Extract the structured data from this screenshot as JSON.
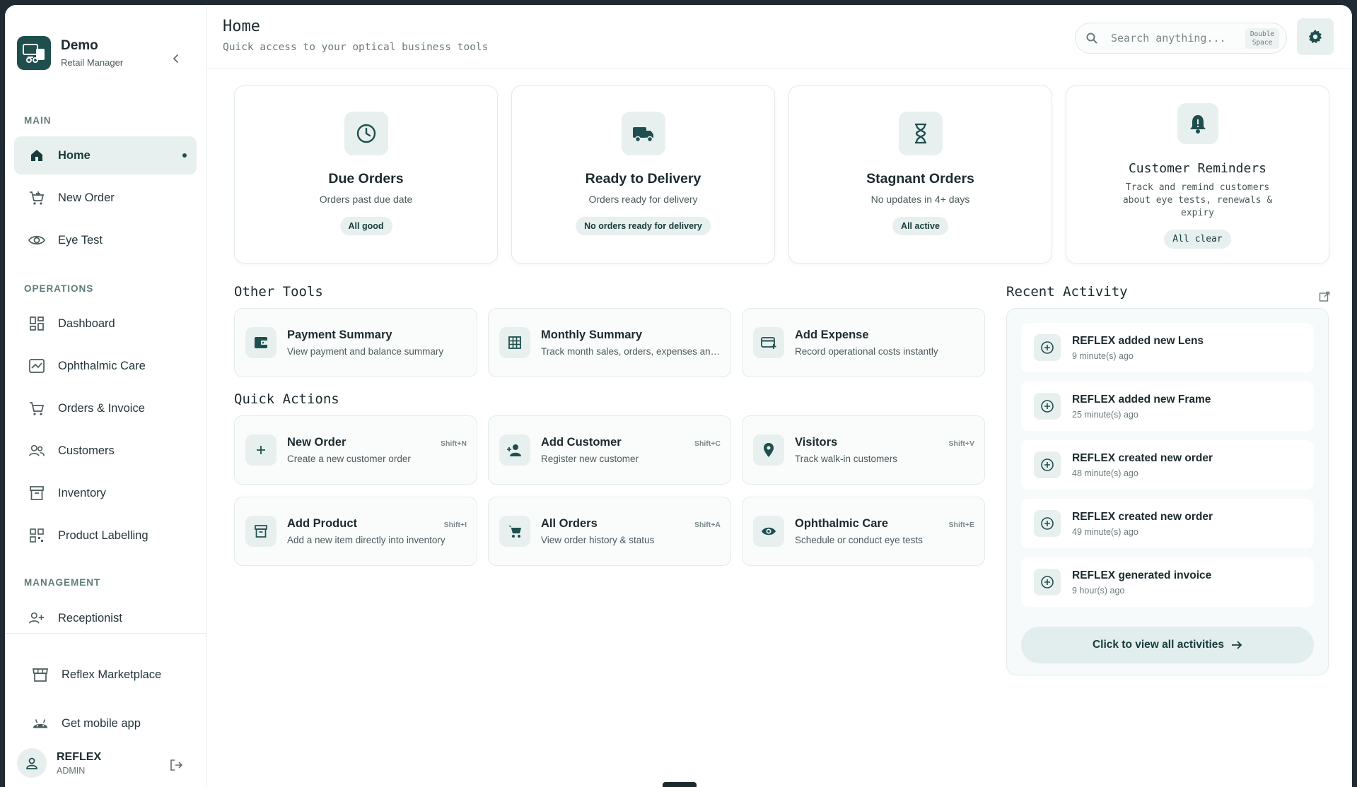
{
  "brand": {
    "name": "Demo",
    "role": "Retail Manager"
  },
  "sidebar": {
    "sections": {
      "main": "MAIN",
      "operations": "OPERATIONS",
      "management": "MANAGEMENT"
    },
    "items": [
      {
        "label": "Home",
        "icon": "home-icon"
      },
      {
        "label": "New Order",
        "icon": "cart-plus-icon"
      },
      {
        "label": "Eye Test",
        "icon": "eye-icon"
      },
      {
        "label": "Dashboard",
        "icon": "dashboard-icon"
      },
      {
        "label": "Ophthalmic Care",
        "icon": "chart-icon"
      },
      {
        "label": "Orders & Invoice",
        "icon": "cart-icon"
      },
      {
        "label": "Customers",
        "icon": "users-icon"
      },
      {
        "label": "Inventory",
        "icon": "archive-icon"
      },
      {
        "label": "Product Labelling",
        "icon": "qr-icon"
      },
      {
        "label": "Receptionist",
        "icon": "user-plus-icon"
      },
      {
        "label": "Reflex Marketplace",
        "icon": "store-icon"
      },
      {
        "label": "Get mobile app",
        "icon": "android-icon"
      }
    ],
    "user": {
      "name": "REFLEX",
      "role": "ADMIN"
    }
  },
  "header": {
    "title": "Home",
    "subtitle": "Quick access to your optical business tools",
    "search_placeholder": "Search anything...",
    "search_shortcut_line1": "Double",
    "search_shortcut_line2": "Space"
  },
  "stats": [
    {
      "title": "Due Orders",
      "desc": "Orders past due date",
      "badge": "All good",
      "icon": "clock-icon"
    },
    {
      "title": "Ready to Delivery",
      "desc": "Orders ready for delivery",
      "badge": "No orders ready for delivery",
      "icon": "truck-icon"
    },
    {
      "title": "Stagnant Orders",
      "desc": "No updates in 4+ days",
      "badge": "All active",
      "icon": "hourglass-icon"
    },
    {
      "title": "Customer Reminders",
      "desc": "Track and remind customers about eye tests, renewals & expiry",
      "badge": "All clear",
      "icon": "bell-icon"
    }
  ],
  "other_tools": {
    "title": "Other Tools",
    "items": [
      {
        "title": "Payment Summary",
        "desc": "View payment and balance summary"
      },
      {
        "title": "Monthly Summary",
        "desc": "Track month sales, orders, expenses and more"
      },
      {
        "title": "Add Expense",
        "desc": "Record operational costs instantly"
      }
    ]
  },
  "quick_actions": {
    "title": "Quick Actions",
    "items": [
      {
        "title": "New Order",
        "desc": "Create a new customer order",
        "shortcut": "Shift+N"
      },
      {
        "title": "Add Customer",
        "desc": "Register new customer",
        "shortcut": "Shift+C"
      },
      {
        "title": "Visitors",
        "desc": "Track walk-in customers",
        "shortcut": "Shift+V"
      },
      {
        "title": "Add Product",
        "desc": "Add a new item directly into inventory",
        "shortcut": "Shift+I"
      },
      {
        "title": "All Orders",
        "desc": "View order history & status",
        "shortcut": "Shift+A"
      },
      {
        "title": "Ophthalmic Care",
        "desc": "Schedule or conduct eye tests",
        "shortcut": "Shift+E"
      }
    ]
  },
  "recent_activity": {
    "title": "Recent Activity",
    "items": [
      {
        "title": "REFLEX added new Lens",
        "time": "9 minute(s) ago"
      },
      {
        "title": "REFLEX added new Frame",
        "time": "25 minute(s) ago"
      },
      {
        "title": "REFLEX created new order",
        "time": "48 minute(s) ago"
      },
      {
        "title": "REFLEX created new order",
        "time": "49 minute(s) ago"
      },
      {
        "title": "REFLEX generated invoice",
        "time": "9 hour(s) ago"
      }
    ],
    "view_all": "Click to view all activities"
  },
  "colors": {
    "accent": "#1f4f4d",
    "accent_soft": "#e7f0ef",
    "frame_bg": "#1f2a33"
  }
}
